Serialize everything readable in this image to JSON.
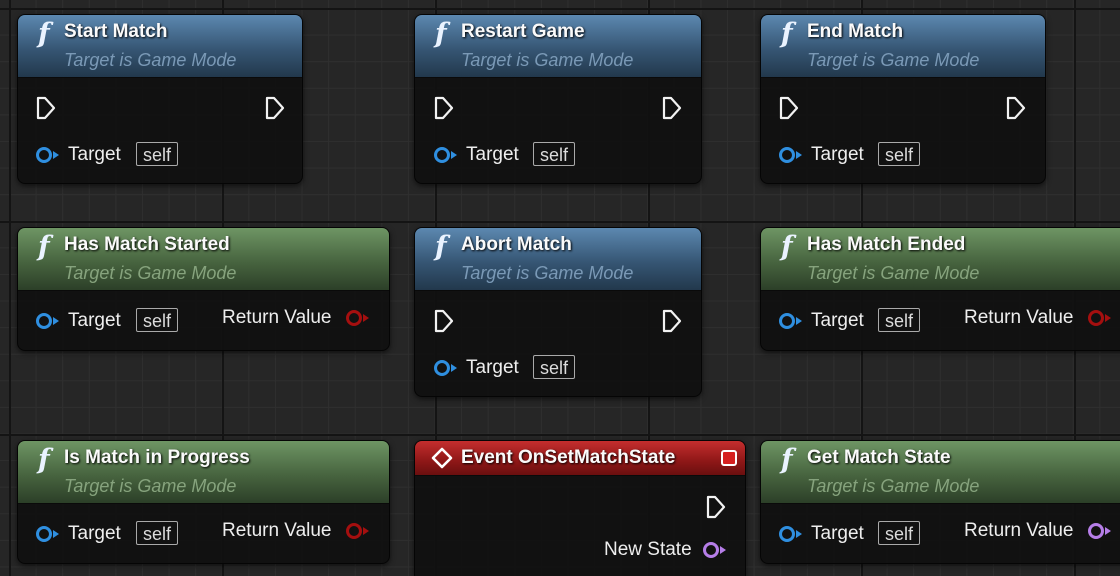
{
  "common": {
    "target_label": "Target",
    "self_label": "self",
    "return_label": "Return Value",
    "subtitle": "Target is Game Mode"
  },
  "nodes": {
    "start_match": {
      "title": "Start Match"
    },
    "restart_game": {
      "title": "Restart Game"
    },
    "end_match": {
      "title": "End Match"
    },
    "has_match_started": {
      "title": "Has Match Started"
    },
    "abort_match": {
      "title": "Abort Match"
    },
    "has_match_ended": {
      "title": "Has Match Ended"
    },
    "is_match_in_progress": {
      "title": "Is Match in Progress"
    },
    "event_on_set_match_state": {
      "title": "Event OnSetMatchState",
      "output_label": "New State"
    },
    "get_match_state": {
      "title": "Get Match State"
    }
  },
  "colors": {
    "object_pin": "#2f8fe0",
    "bool_pin": "#a50f0f",
    "struct_pin": "#b67ee8",
    "blue_header": "#365674",
    "green_header": "#47643f",
    "event_header": "#8e1717"
  },
  "icons": {
    "function": "f",
    "event": "diamond-icon",
    "exec": "exec-pin-icon"
  }
}
